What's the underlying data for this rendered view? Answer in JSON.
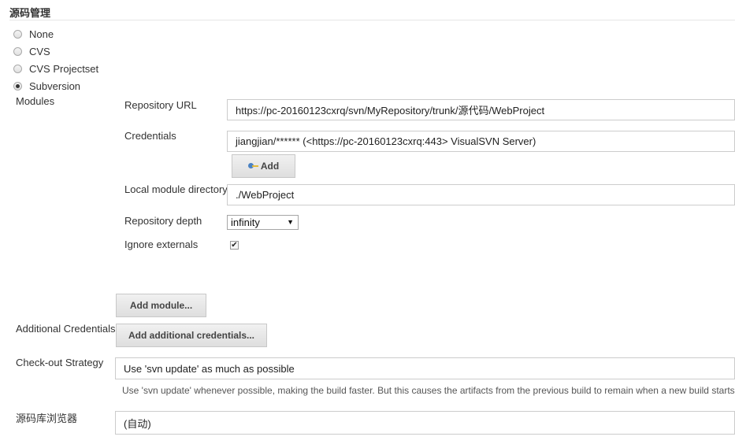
{
  "section": {
    "title": "源码管理"
  },
  "scm_options": [
    {
      "label": "None",
      "checked": false
    },
    {
      "label": "CVS",
      "checked": false
    },
    {
      "label": "CVS Projectset",
      "checked": false
    },
    {
      "label": "Subversion",
      "checked": true
    }
  ],
  "modules": {
    "label": "Modules",
    "repository_url": {
      "label": "Repository URL",
      "value": "https://pc-20160123cxrq/svn/MyRepository/trunk/源代码/WebProject"
    },
    "credentials": {
      "label": "Credentials",
      "value": "jiangjian/****** (<https://pc-20160123cxrq:443> VisualSVN Server)",
      "add_button": "Add",
      "add_icon": "key-icon"
    },
    "local_module_directory": {
      "label": "Local module directory",
      "value": "./WebProject"
    },
    "repository_depth": {
      "label": "Repository depth",
      "value": "infinity",
      "arrow": "▼"
    },
    "ignore_externals": {
      "label": "Ignore externals",
      "checked": true,
      "mark": "✔"
    },
    "add_module_button": "Add module..."
  },
  "additional_credentials": {
    "label": "Additional Credentials",
    "button": "Add additional credentials..."
  },
  "checkout_strategy": {
    "label": "Check-out Strategy",
    "value": "Use 'svn update' as much as possible",
    "help": "Use 'svn update' whenever possible, making the build faster. But this causes the artifacts from the previous build to remain when a new build starts."
  },
  "repo_browser": {
    "label": "源码库浏览器",
    "value": "(自动)"
  }
}
